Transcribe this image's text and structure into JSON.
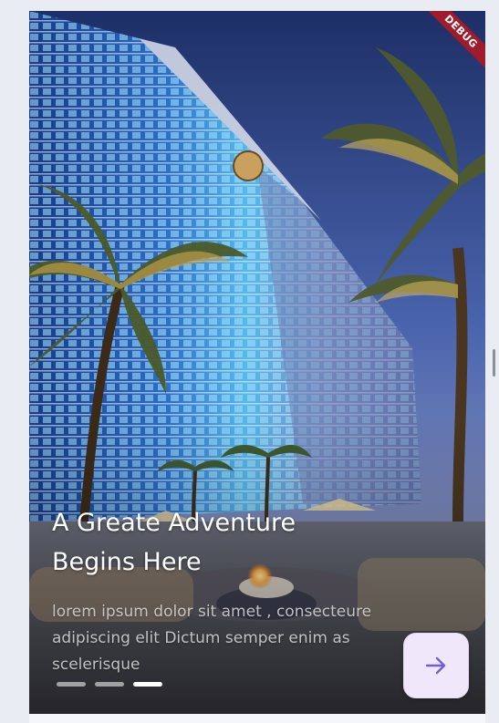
{
  "onboarding": {
    "title": "A Greate Adventure Begins Here",
    "description": "lorem ipsum dolor sit amet , consecteure adipiscing elit Dictum semper enim as scelerisque",
    "page_indicator": {
      "total": 3,
      "active_index": 2
    },
    "next_button": {
      "icon": "arrow-right-icon"
    }
  },
  "debug_banner": {
    "label": "DEBUG"
  },
  "colors": {
    "button_bg": "#f1e7fb",
    "button_icon": "#6f5fd6",
    "banner": "#a01b2c",
    "dot_active": "#ffffff",
    "dot_inactive": "#c8c8c8"
  }
}
